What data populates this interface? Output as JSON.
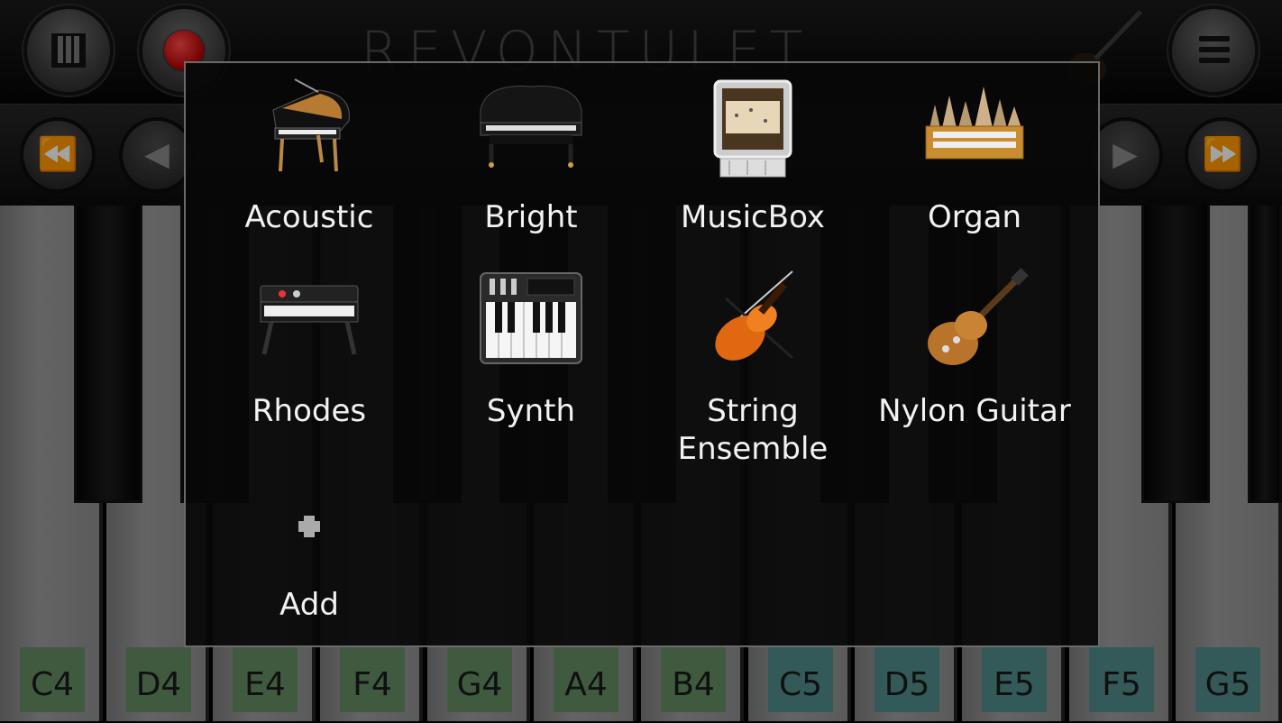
{
  "app": {
    "brand": "REVONTULET"
  },
  "header": {
    "keys_button": "piano-keys-icon",
    "record_button": "record-icon",
    "menu_button": "menu-list-icon"
  },
  "transport": {
    "rewind": "⏪",
    "previous": "◀",
    "next": "▶",
    "fast_forward": "⏩"
  },
  "keyboard": {
    "notes": [
      "C4",
      "D4",
      "E4",
      "F4",
      "G4",
      "A4",
      "B4",
      "C5",
      "D5",
      "E5",
      "F5",
      "G5"
    ],
    "colors": {
      "octave4": "#628a62",
      "octave5": "#4f8a88"
    }
  },
  "instrument_dialog": {
    "items": [
      {
        "label": "Acoustic",
        "icon": "grand-piano-icon"
      },
      {
        "label": "Bright",
        "icon": "black-grand-piano-icon"
      },
      {
        "label": "MusicBox",
        "icon": "music-box-icon"
      },
      {
        "label": "Organ",
        "icon": "pipe-organ-icon"
      },
      {
        "label": "Rhodes",
        "icon": "electric-piano-icon"
      },
      {
        "label": "Synth",
        "icon": "synthesizer-icon"
      },
      {
        "label": "String\nEnsemble",
        "icon": "violin-icon"
      },
      {
        "label": "Nylon Guitar",
        "icon": "guitar-icon"
      },
      {
        "label": "Add",
        "icon": "plus-icon"
      }
    ]
  }
}
